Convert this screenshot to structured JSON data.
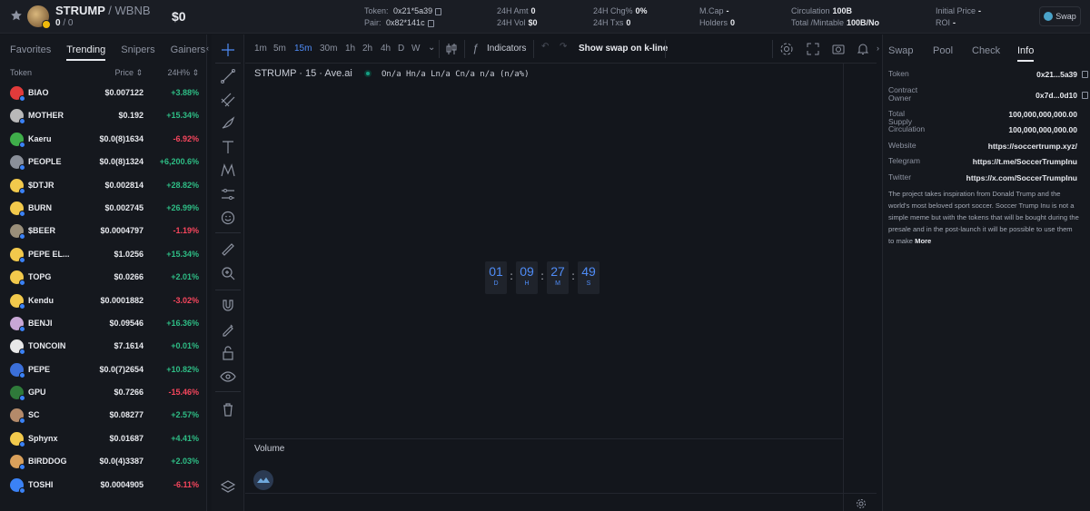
{
  "header": {
    "pair_base": "STRUMP",
    "pair_quote": "/ WBNB",
    "holdings": "0",
    "holdings_sep": "/ 0",
    "price": "$0",
    "token_label": "Token:",
    "token_value": "0x21*5a39",
    "pair_label": "Pair:",
    "pair_value": "0x82*141c",
    "amt_label": "24H Amt",
    "amt_value": "0",
    "vol_label": "24H Vol",
    "vol_value": "$0",
    "chg_label": "24H Chg%",
    "chg_value": "0%",
    "txs_label": "24H Txs",
    "txs_value": "0",
    "mcap_label": "M.Cap",
    "mcap_value": "-",
    "holders_label": "Holders",
    "holders_value": "0",
    "circ_label": "Circulation",
    "circ_value": "100B",
    "total_label": "Total /Mintable",
    "total_value": "100B/No",
    "init_label": "Initial Price",
    "init_value": "-",
    "roi_label": "ROI",
    "roi_value": "-",
    "swap_label": "Swap"
  },
  "left": {
    "tabs": [
      "Favorites",
      "Trending",
      "Snipers",
      "Gainers"
    ],
    "active_tab": "Trending",
    "col_token": "Token",
    "col_price": "Price ⇕",
    "col_24h": "24H% ⇕",
    "tokens": [
      {
        "name": "BIAO",
        "price": "$0.007122",
        "change": "+3.88%",
        "dir": "up",
        "color": "#e23b3b"
      },
      {
        "name": "MOTHER",
        "price": "$0.192",
        "change": "+15.34%",
        "dir": "up",
        "color": "#b9b9b9"
      },
      {
        "name": "Kaeru",
        "price": "$0.0(8)1634",
        "change": "-6.92%",
        "dir": "down",
        "color": "#3fae4a"
      },
      {
        "name": "PEOPLE",
        "price": "$0.0(8)1324",
        "change": "+6,200.6%",
        "dir": "up",
        "color": "#8a8f99"
      },
      {
        "name": "$DTJR",
        "price": "$0.002814",
        "change": "+28.82%",
        "dir": "up",
        "color": "#f2c94c"
      },
      {
        "name": "BURN",
        "price": "$0.002745",
        "change": "+26.99%",
        "dir": "up",
        "color": "#f2c94c"
      },
      {
        "name": "$BEER",
        "price": "$0.0004797",
        "change": "-1.19%",
        "dir": "down",
        "color": "#9a8f7a"
      },
      {
        "name": "PEPE EL...",
        "price": "$1.0256",
        "change": "+15.34%",
        "dir": "up",
        "color": "#f2c94c"
      },
      {
        "name": "TOPG",
        "price": "$0.0266",
        "change": "+2.01%",
        "dir": "up",
        "color": "#f2c94c"
      },
      {
        "name": "Kendu",
        "price": "$0.0001882",
        "change": "-3.02%",
        "dir": "down",
        "color": "#f2c94c"
      },
      {
        "name": "BENJI",
        "price": "$0.09546",
        "change": "+16.36%",
        "dir": "up",
        "color": "#c9a7d6"
      },
      {
        "name": "TONCOIN",
        "price": "$7.1614",
        "change": "+0.01%",
        "dir": "up",
        "color": "#e8e8e8"
      },
      {
        "name": "PEPE",
        "price": "$0.0(7)2654",
        "change": "+10.82%",
        "dir": "up",
        "color": "#3b6fd9"
      },
      {
        "name": "GPU",
        "price": "$0.7266",
        "change": "-15.46%",
        "dir": "down",
        "color": "#2f7a3a"
      },
      {
        "name": "SC",
        "price": "$0.08277",
        "change": "+2.57%",
        "dir": "up",
        "color": "#b48a6a"
      },
      {
        "name": "Sphynx",
        "price": "$0.01687",
        "change": "+4.41%",
        "dir": "up",
        "color": "#f2c94c"
      },
      {
        "name": "BIRDDOG",
        "price": "$0.0(4)3387",
        "change": "+2.03%",
        "dir": "up",
        "color": "#d9a05b"
      },
      {
        "name": "TOSHI",
        "price": "$0.0004905",
        "change": "-6.11%",
        "dir": "down",
        "color": "#3b82f6"
      }
    ]
  },
  "chart": {
    "timeframes": [
      "1m",
      "5m",
      "15m",
      "30m",
      "1h",
      "2h",
      "4h",
      "D",
      "W"
    ],
    "active_tf": "15m",
    "indicators_label": "Indicators",
    "show_swap_label": "Show swap on k-line",
    "legend_title": "STRUMP · 15 · Ave.ai",
    "legend_ohlc": "On/a Hn/a Ln/a Cn/a n/a (n/a%)",
    "volume_label": "Volume",
    "countdown": [
      {
        "value": "01",
        "unit": "D"
      },
      {
        "value": "09",
        "unit": "H"
      },
      {
        "value": "27",
        "unit": "M"
      },
      {
        "value": "49",
        "unit": "S"
      }
    ]
  },
  "right": {
    "tabs": [
      "Swap",
      "Pool",
      "Check",
      "Info"
    ],
    "active_tab": "Info",
    "rows": [
      {
        "key": "Token",
        "value": "0x21...5a39",
        "copy": true
      },
      {
        "key": "Contract Owner",
        "value": "0x7d...0d10",
        "copy": true
      },
      {
        "key": "Total Supply",
        "value": "100,000,000,000.00"
      },
      {
        "key": "Circulation",
        "value": "100,000,000,000.00"
      },
      {
        "key": "Website",
        "value": "https://soccertrump.xyz/"
      },
      {
        "key": "Telegram",
        "value": "https://t.me/SoccerTrumpInu"
      },
      {
        "key": "Twitter",
        "value": "https://x.com/SoccerTrumpInu"
      }
    ],
    "description": "The project takes inspiration from Donald Trump and the world's most beloved sport soccer. Soccer Trump Inu is not a simple meme but with the tokens that will be bought during the presale and in the post-launch it will be possible to use them to make",
    "more_label": "More"
  },
  "colors": {
    "accent": "#4f8cf7",
    "up": "#2ebd85",
    "down": "#f6465d"
  }
}
